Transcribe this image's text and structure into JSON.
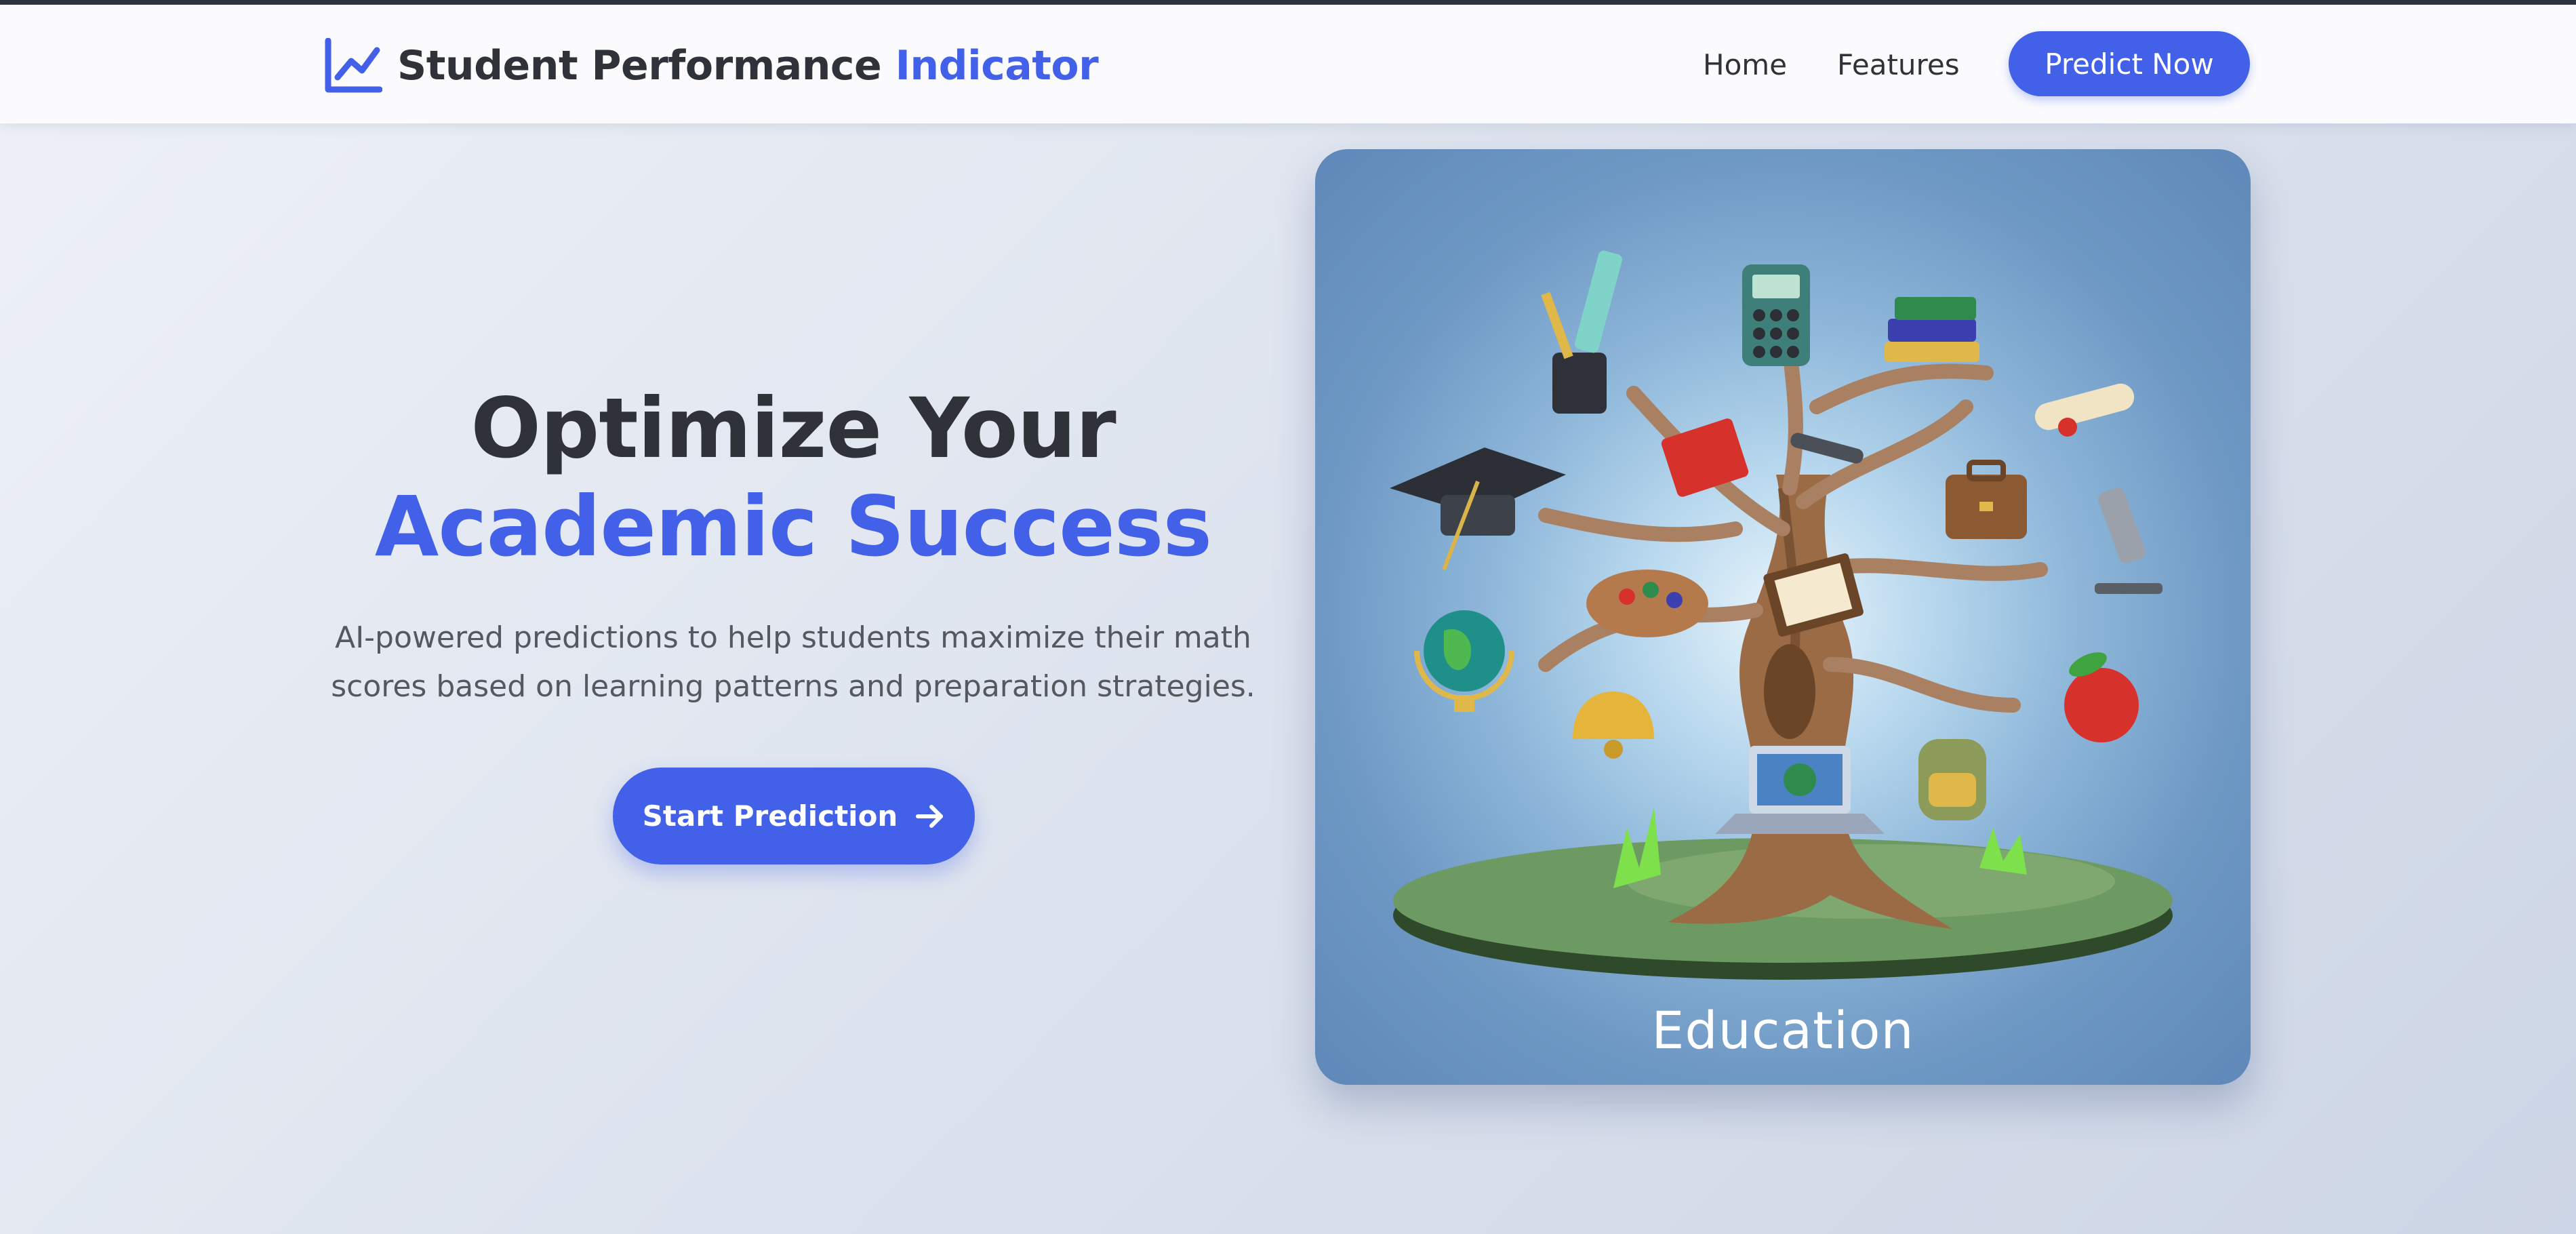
{
  "brand": {
    "name_part1": "Student Performance",
    "name_part2": "Indicator",
    "icon": "chart-line-icon"
  },
  "nav": {
    "items": [
      {
        "label": "Home"
      },
      {
        "label": "Features"
      }
    ],
    "cta_label": "Predict Now"
  },
  "hero": {
    "title_line1": "Optimize Your",
    "title_line2": "Academic Success",
    "description": "AI-powered predictions to help students maximize their math scores based on learning patterns and preparation strategies.",
    "button_label": "Start Prediction",
    "button_icon": "arrow-right-icon"
  },
  "image": {
    "caption": "Education"
  },
  "colors": {
    "accent": "#4360e8",
    "text_dark": "#2f3238",
    "text_muted": "#55595f"
  }
}
